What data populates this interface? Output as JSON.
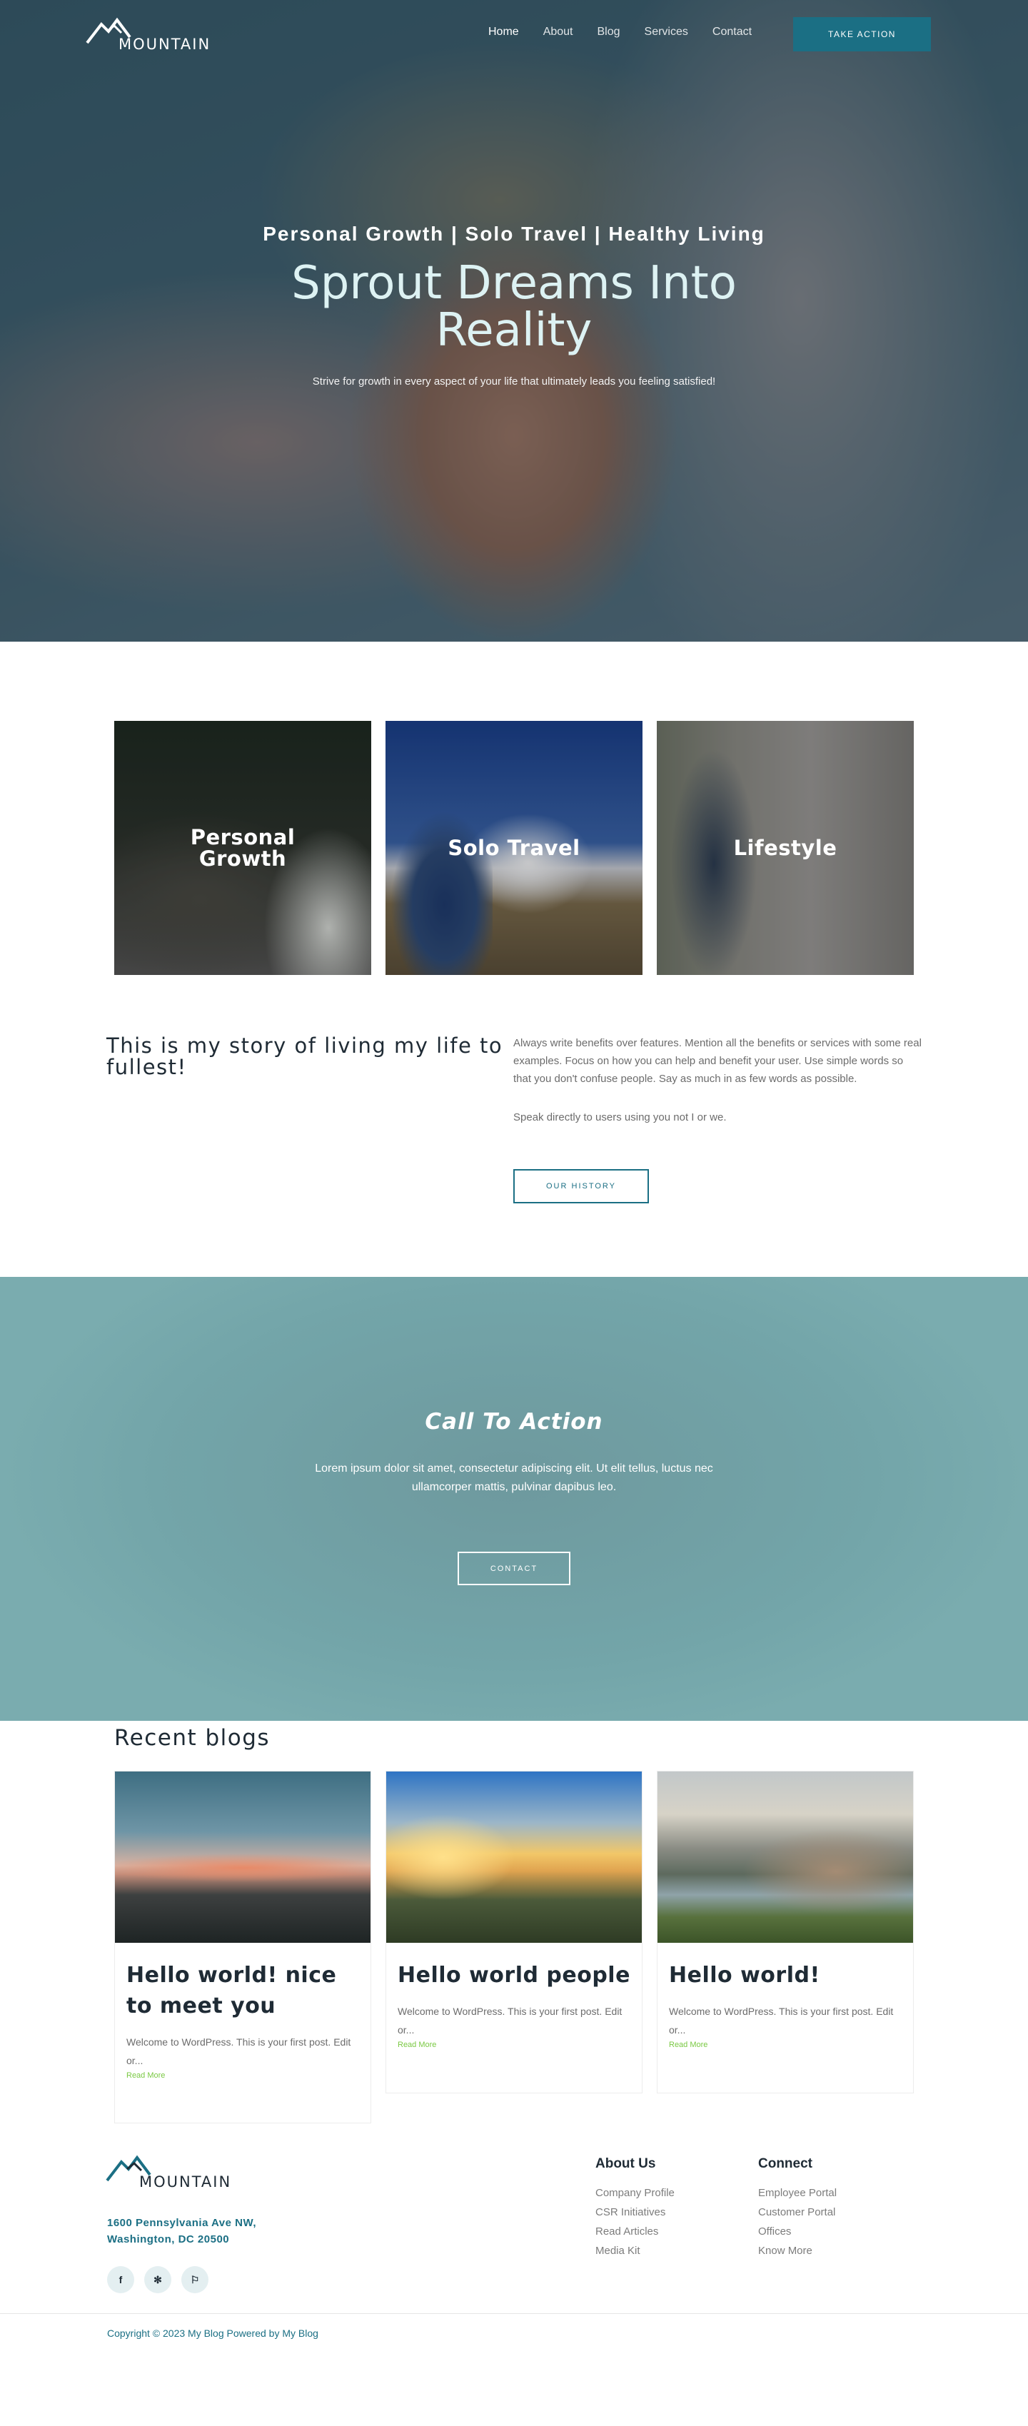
{
  "brand": {
    "name": "MOUNTAIN"
  },
  "nav": {
    "items": [
      "Home",
      "About",
      "Blog",
      "Services",
      "Contact"
    ],
    "cta": "TAKE ACTION"
  },
  "hero": {
    "kicker": "Personal Growth | Solo Travel | Healthy Living",
    "title": "Sprout Dreams Into Reality",
    "subtitle": "Strive for growth in every aspect of your life that ultimately leads you feeling satisfied!"
  },
  "tiles": [
    {
      "label": "Personal Growth"
    },
    {
      "label": "Solo Travel"
    },
    {
      "label": "Lifestyle"
    }
  ],
  "story": {
    "title": "This is my story of living my life to fullest!",
    "paragraph1": "Always write benefits over features. Mention all the benefits or services with some real examples. Focus on how you can help and benefit your user. Use simple words so that you don't confuse people. Say as much in as few words as possible.",
    "paragraph2": "Speak directly to users using you not I or we.",
    "button": "OUR HISTORY"
  },
  "cta": {
    "title": "Call To Action",
    "text": "Lorem ipsum dolor sit amet, consectetur adipiscing elit. Ut elit tellus, luctus nec ullamcorper mattis, pulvinar dapibus leo.",
    "button": "CONTACT"
  },
  "blogs": {
    "title": "Recent blogs",
    "posts": [
      {
        "title": "Hello world! nice to meet you",
        "excerpt": "Welcome to WordPress. This is your first post. Edit or...",
        "more": "Read More"
      },
      {
        "title": "Hello world people",
        "excerpt": "Welcome to WordPress. This is your first post. Edit or...",
        "more": "Read More"
      },
      {
        "title": "Hello world!",
        "excerpt": "Welcome to WordPress. This is your first post. Edit or...",
        "more": "Read More"
      }
    ]
  },
  "footer": {
    "address_line1": "1600 Pennsylvania Ave NW,",
    "address_line2": "Washington, DC 20500",
    "socials": [
      "facebook-icon",
      "yelp-icon",
      "foursquare-icon"
    ],
    "columns": [
      {
        "title": "About Us",
        "links": [
          "Company Profile",
          "CSR Initiatives",
          "Read Articles",
          "Media Kit"
        ]
      },
      {
        "title": "Connect",
        "links": [
          "Employee Portal",
          "Customer Portal",
          "Offices",
          "Know More"
        ]
      }
    ],
    "copyright": "Copyright © 2023 My Blog Powered by My Blog"
  },
  "colors": {
    "accent": "#1b6f84",
    "cta_bg": "#73a5a9",
    "read_more": "#7ac943"
  }
}
